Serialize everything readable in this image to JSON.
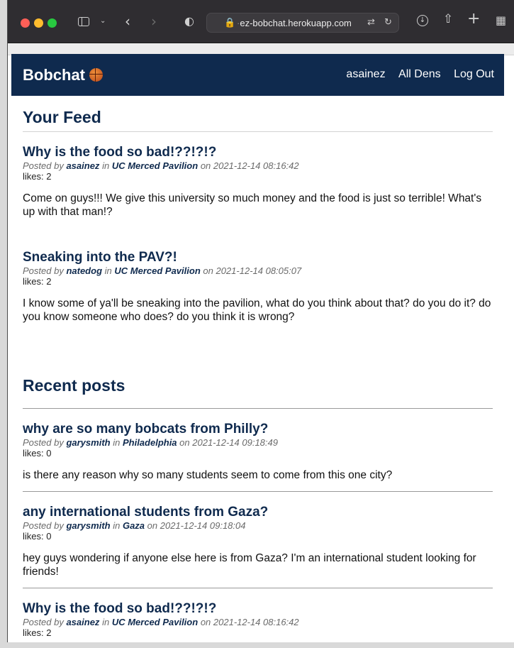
{
  "browser": {
    "url_prefix": "ez-bobchat.herokuapp.com",
    "url_faded": "·"
  },
  "nav": {
    "brand": "Bobchat",
    "links": [
      "asainez",
      "All Dens",
      "Log Out"
    ]
  },
  "feed": {
    "title": "Your Feed",
    "posts": [
      {
        "title": "Why is the food so bad!??!?!?",
        "posted_by": "Posted by",
        "author": "asainez",
        "in": "in",
        "den": "UC Merced Pavilion",
        "on": "on",
        "date": "2021-12-14 08:16:42",
        "likes": "likes: 2",
        "body": "Come on guys!!! We give this university so much money and the food is just so terrible! What's up with that man!?"
      },
      {
        "title": "Sneaking into the PAV?!",
        "posted_by": "Posted by",
        "author": "natedog",
        "in": "in",
        "den": "UC Merced Pavilion",
        "on": "on",
        "date": "2021-12-14 08:05:07",
        "likes": "likes: 2",
        "body": "I know some of ya'll be sneaking into the pavilion, what do you think about that? do you do it? do you know someone who does? do you think it is wrong?"
      }
    ]
  },
  "recent": {
    "title": "Recent posts",
    "posts": [
      {
        "title": "why are so many bobcats from Philly?",
        "posted_by": "Posted by",
        "author": "garysmith",
        "in": "in",
        "den": "Philadelphia",
        "on": "on",
        "date": "2021-12-14 09:18:49",
        "likes": "likes: 0",
        "body": "is there any reason why so many students seem to come from this one city?"
      },
      {
        "title": "any international students from Gaza?",
        "posted_by": "Posted by",
        "author": "garysmith",
        "in": "in",
        "den": "Gaza",
        "on": "on",
        "date": "2021-12-14 09:18:04",
        "likes": "likes: 0",
        "body": "hey guys wondering if anyone else here is from Gaza? I'm an international student looking for friends!"
      },
      {
        "title": "Why is the food so bad!??!?!?",
        "posted_by": "Posted by",
        "author": "asainez",
        "in": "in",
        "den": "UC Merced Pavilion",
        "on": "on",
        "date": "2021-12-14 08:16:42",
        "likes": "likes: 2",
        "body": ""
      }
    ]
  }
}
